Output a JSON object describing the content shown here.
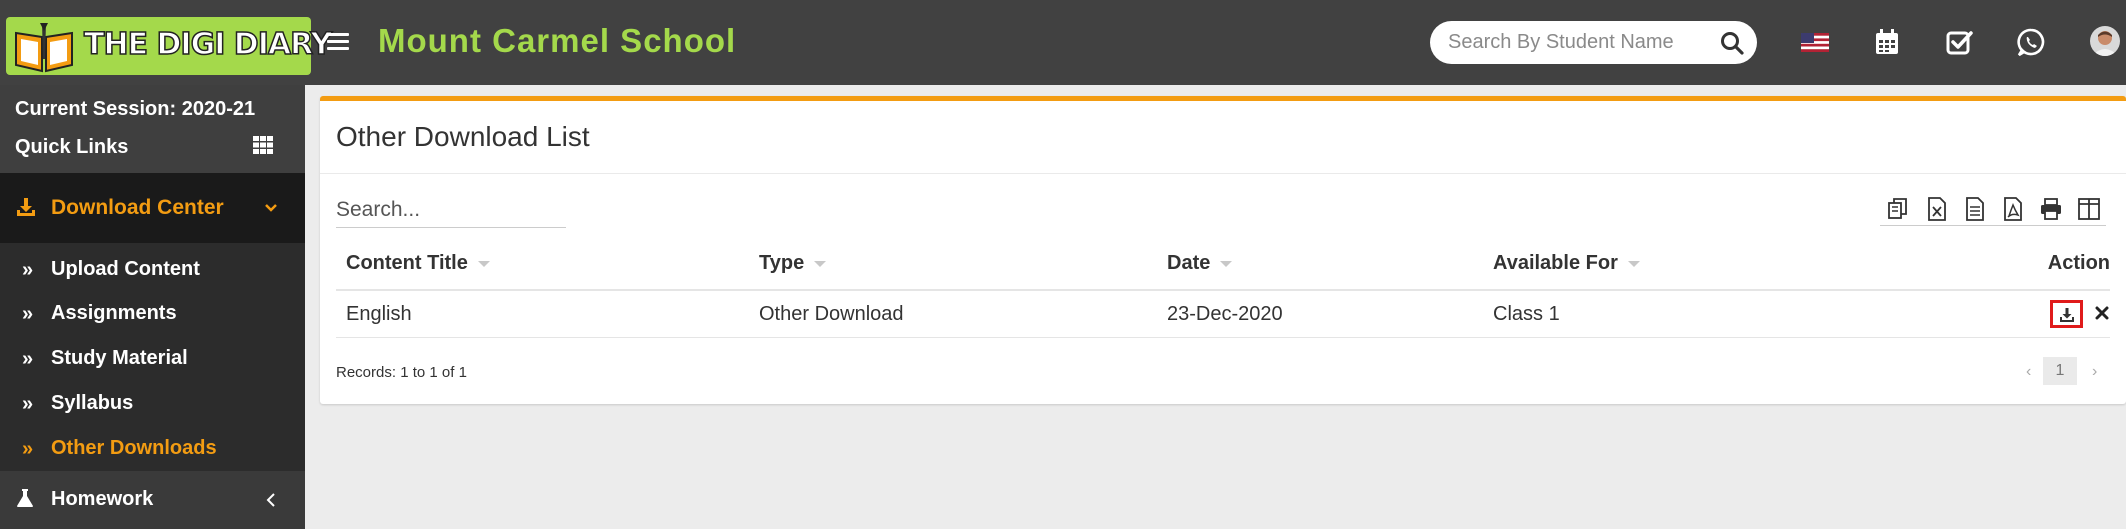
{
  "header": {
    "logo_text": "THE DIGI DIARY",
    "school_name": "Mount Carmel School",
    "search_placeholder": "Search By Student Name",
    "icons": [
      "menu-icon",
      "search-icon",
      "us-flag-icon",
      "calendar-icon",
      "checkbox-icon",
      "whatsapp-icon",
      "user-avatar"
    ]
  },
  "sidebar": {
    "session": "Current Session: 2020-21",
    "quick_links": "Quick Links",
    "active_menu": {
      "label": "Download Center",
      "icon": "download-icon"
    },
    "items": [
      {
        "label": "Upload Content",
        "active": false
      },
      {
        "label": "Assignments",
        "active": false
      },
      {
        "label": "Study Material",
        "active": false
      },
      {
        "label": "Syllabus",
        "active": false
      },
      {
        "label": "Other Downloads",
        "active": true
      }
    ],
    "homework": {
      "label": "Homework",
      "icon": "flask-icon"
    }
  },
  "main": {
    "title": "Other Download List",
    "search_placeholder": "Search...",
    "export_buttons": [
      "copy-icon",
      "excel-icon",
      "csv-icon",
      "pdf-icon",
      "print-icon",
      "columns-icon"
    ],
    "columns": [
      "Content Title",
      "Type",
      "Date",
      "Available For",
      "Action"
    ],
    "rows": [
      {
        "content_title": "English",
        "type": "Other Download",
        "date": "23-Dec-2020",
        "available_for": "Class 1"
      }
    ],
    "records": "Records: 1 to 1 of 1",
    "pager": {
      "prev": "‹",
      "page": "1",
      "next": "›"
    }
  },
  "colors": {
    "topbar": "#414141",
    "accent_green": "#a4d94b",
    "accent_orange": "#f39c12",
    "sidebar": "#222d32",
    "highlight_red": "#e01b1b"
  }
}
